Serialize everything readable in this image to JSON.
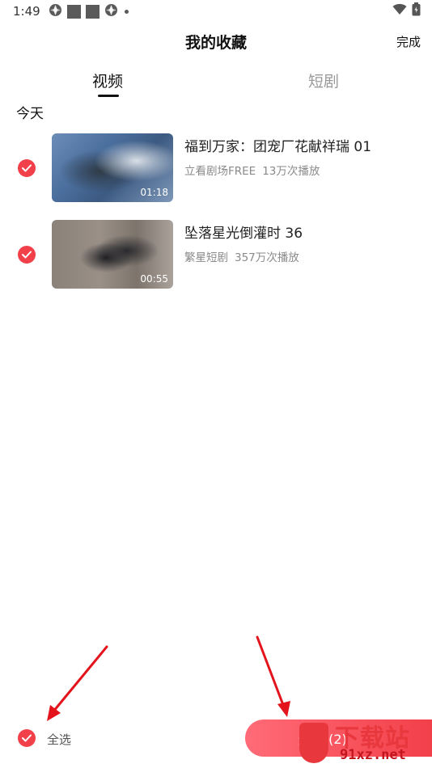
{
  "status_bar": {
    "time": "1:49",
    "icons_left": [
      "aperture-icon",
      "square-icon",
      "square-icon",
      "aperture-icon",
      "dot-icon"
    ],
    "icons_right": [
      "wifi-icon",
      "battery-icon"
    ]
  },
  "header": {
    "title": "我的收藏",
    "done_label": "完成"
  },
  "tabs": [
    {
      "label": "视频",
      "active": true
    },
    {
      "label": "短剧",
      "active": false
    }
  ],
  "section": {
    "label": "今天"
  },
  "items": [
    {
      "title": "福到万家：团宠厂花献祥瑞 01",
      "source": "立看剧场FREE",
      "plays": "13万次播放",
      "duration": "01:18",
      "selected": true
    },
    {
      "title": "坠落星光倒灌时 36",
      "source": "繁星短剧",
      "plays": "357万次播放",
      "duration": "00:55",
      "selected": true
    }
  ],
  "bottom_bar": {
    "select_all_label": "全选",
    "delete_label": "删除 (2)"
  },
  "watermark": {
    "top_text": "下载站",
    "bottom_text": "91xz.net"
  },
  "colors": {
    "accent": "#f2404a",
    "annotation_arrow": "#e3141c",
    "text_primary": "#222222",
    "text_secondary": "#8a8a8a"
  }
}
